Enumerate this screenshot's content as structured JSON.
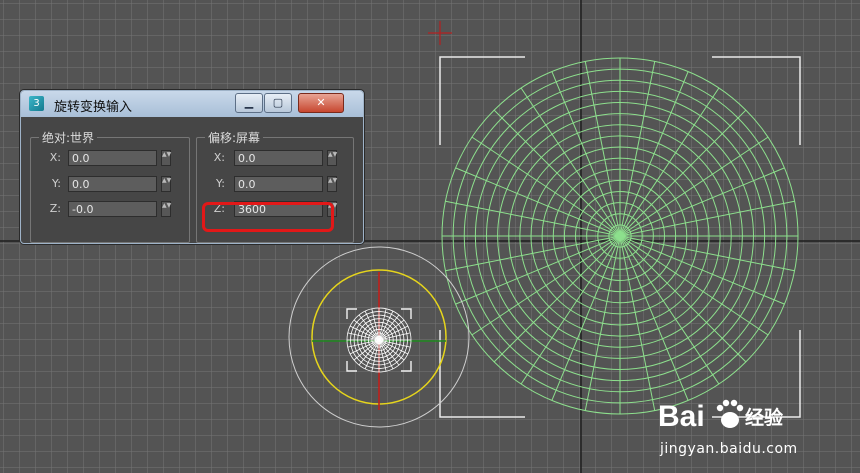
{
  "dialog": {
    "title": "旋转变换输入",
    "app_icon": "3ds-max-app-icon",
    "minimize_label": "▁",
    "maximize_label": "▢",
    "close_label": "✕",
    "absolute_group": {
      "label": "绝对:世界",
      "rows": [
        {
          "axis": "X:",
          "value": "0.0"
        },
        {
          "axis": "Y:",
          "value": "0.0"
        },
        {
          "axis": "Z:",
          "value": "-0.0"
        }
      ]
    },
    "offset_group": {
      "label": "偏移:屏幕",
      "rows": [
        {
          "axis": "X:",
          "value": "0.0"
        },
        {
          "axis": "Y:",
          "value": "0.0"
        },
        {
          "axis": "Z:",
          "value": "3600"
        }
      ]
    },
    "spinner_glyph": "▲▼"
  },
  "watermark": {
    "brand": "Bai",
    "brand_suffix": "经验",
    "url": "jingyan.baidu.com"
  },
  "colors": {
    "viewport_bg": "#545454",
    "wireframe": "#8de08d",
    "gizmo_yellow": "#e6d51c",
    "highlight": "#e21818"
  }
}
